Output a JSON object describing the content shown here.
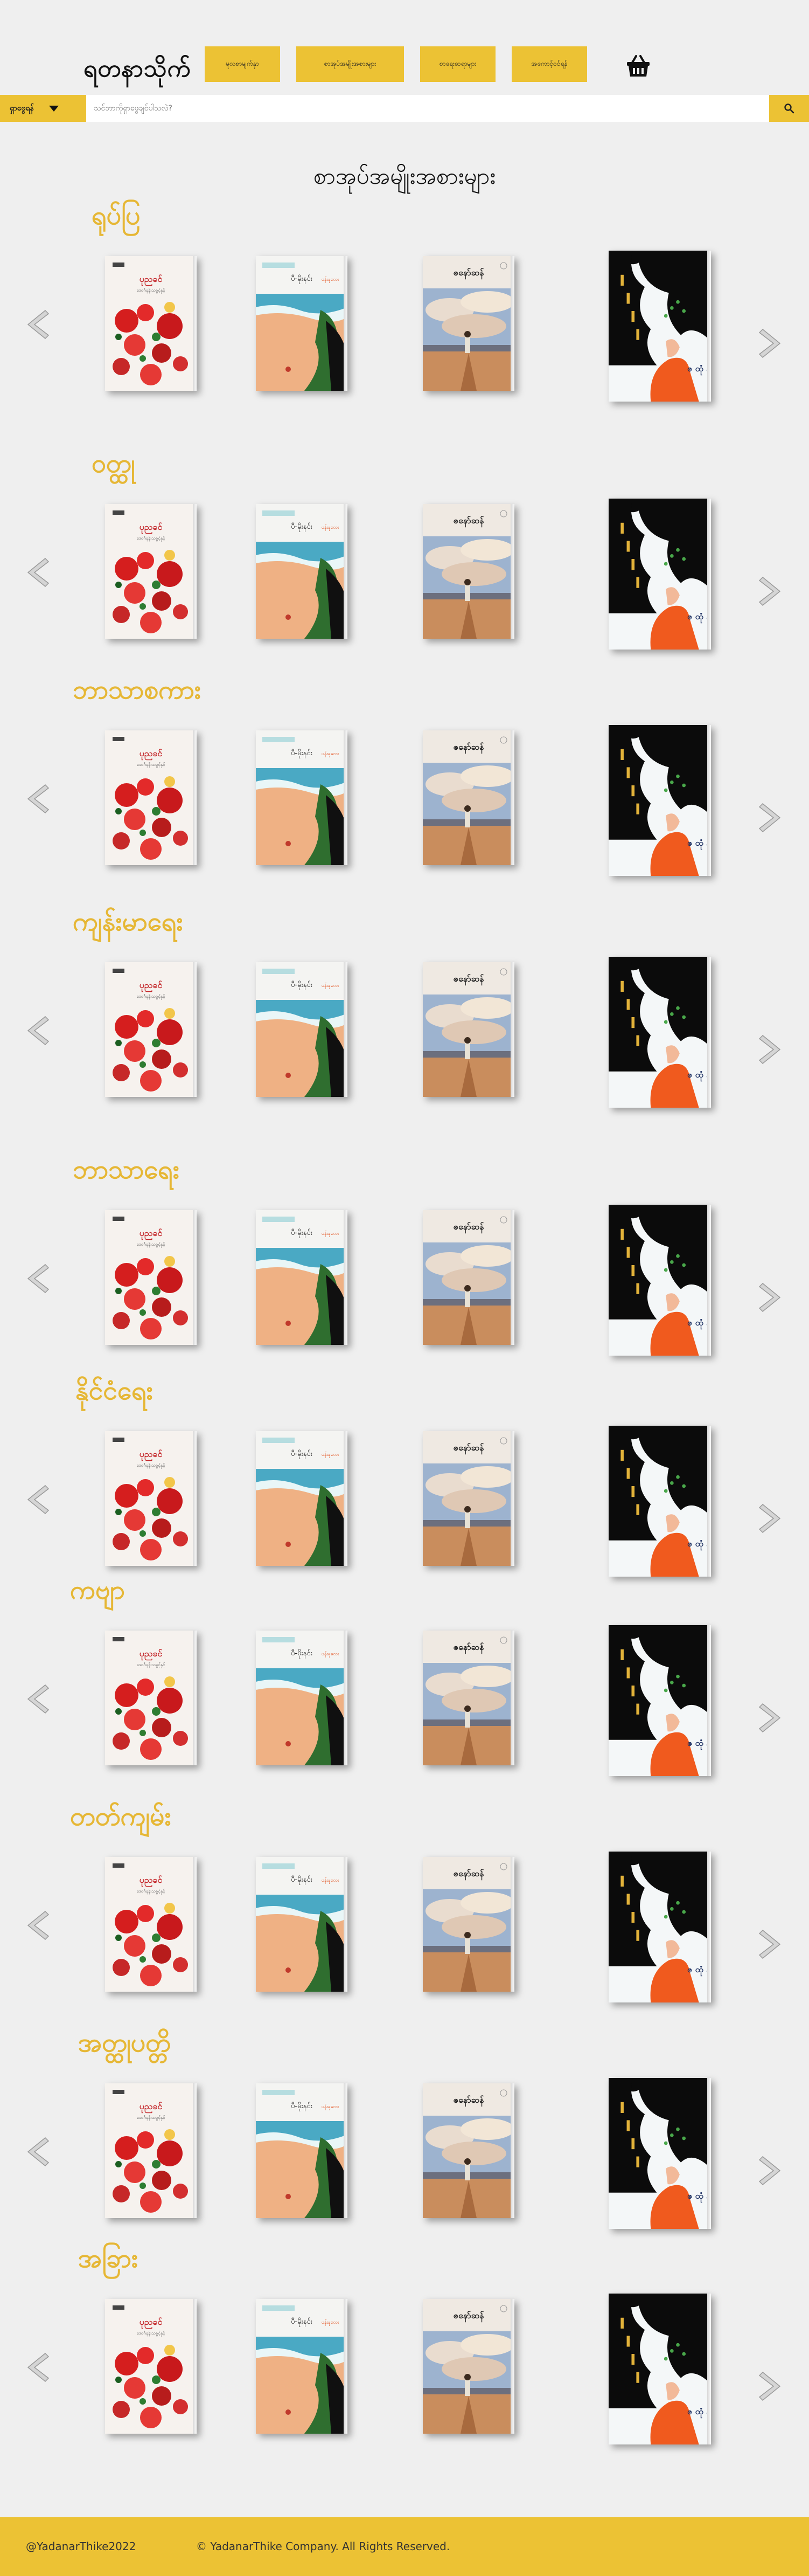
{
  "header": {
    "logo": "ရတနာသိုက်",
    "nav": [
      {
        "label": "မူလစာမျက်နှာ"
      },
      {
        "label": "စာအုပ်အမျိုးအစားများ"
      },
      {
        "label": "စာရေးဆရာများ"
      },
      {
        "label": "အကောင့်ဝင်ရန်"
      }
    ],
    "cart_icon": "shopping-basket-icon"
  },
  "search": {
    "category_label": "ရှာဖွေရန်",
    "placeholder": "သင်ဘာကိုရှာဖွေချင်ပါသလဲ?",
    "button_icon": "search-icon"
  },
  "main": {
    "title": "စာအုပ်အမျိုးအစားများ",
    "categories": [
      {
        "name": "ရုပ်ပြ"
      },
      {
        "name": "ဝတ္ထု"
      },
      {
        "name": "ဘာသာစကား"
      },
      {
        "name": "ကျန်းမာရေး"
      },
      {
        "name": "ဘာသာရေး"
      },
      {
        "name": "နိုင်ငံရေး"
      },
      {
        "name": "ကဗျာ"
      },
      {
        "name": "တတ်ကျမ်း"
      },
      {
        "name": "အတ္ထုပတ္တိ"
      },
      {
        "name": "အခြား"
      }
    ],
    "books": [
      {
        "title": "ပုညခင်",
        "subtitle": "ဒေဝင်္ဂနန်းသခွင့်နှင့်",
        "icon": "book-cover-flowers"
      },
      {
        "title": "ပီ-မိုးနင်း",
        "subtitle": "ပန်းနုလေး",
        "icon": "book-cover-beach"
      },
      {
        "title": "ဇနော်ဆန်",
        "subtitle": "",
        "icon": "book-cover-sky"
      },
      {
        "title": "ဇ ထုံ နဲ့",
        "subtitle": "",
        "icon": "book-cover-hair"
      }
    ]
  },
  "footer": {
    "handle": "@YadanarThike2022",
    "copyright": "© YadanarThike Company. All Rights Reserved."
  },
  "colors": {
    "accent": "#ecc234",
    "category_title": "#e6b735",
    "background": "#efefef"
  }
}
